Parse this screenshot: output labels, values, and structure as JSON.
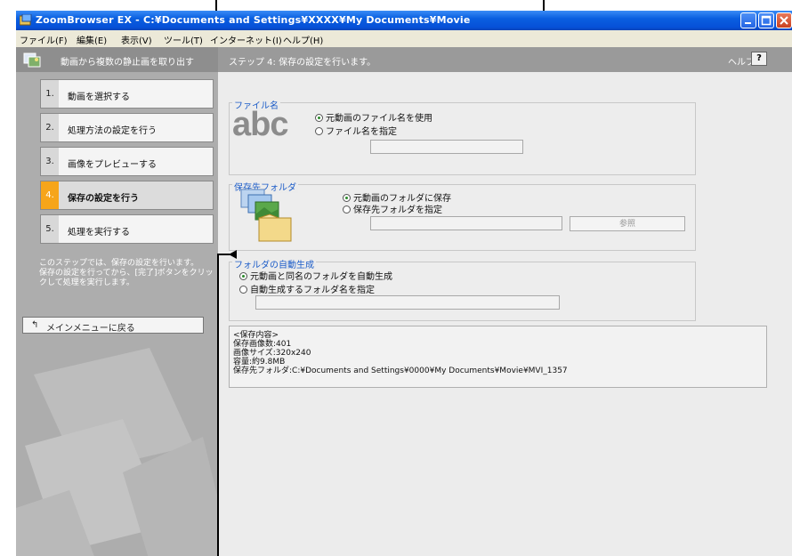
{
  "window": {
    "title": "ZoomBrowser EX - C:¥Documents and Settings¥XXXX¥My Documents¥Movie",
    "help_button_label": "?"
  },
  "menu": [
    "ファイル(F)",
    "編集(E)",
    "表示(V)",
    "ツール(T)",
    "インターネット(I)",
    "ヘルプ(H)"
  ],
  "header": {
    "left_label": "動画から複数の静止画を取り出す",
    "step_title": "ステップ 4: 保存の設定を行います。",
    "help_label": "ヘルプ"
  },
  "steps": [
    {
      "num": "1.",
      "label": "動画を選択する",
      "active": false
    },
    {
      "num": "2.",
      "label": "処理方法の設定を行う",
      "active": false
    },
    {
      "num": "3.",
      "label": "画像をプレビューする",
      "active": false
    },
    {
      "num": "4.",
      "label": "保存の設定を行う",
      "active": true
    },
    {
      "num": "5.",
      "label": "処理を実行する",
      "active": false
    }
  ],
  "step_description": [
    "このステップでは、保存の設定を行います。",
    "保存の設定を行ってから、[完了]ボタンをクリックして処理を実行します。"
  ],
  "main_menu_button": {
    "label": "メインメニューに戻る",
    "icon": "return-arrow-icon"
  },
  "file_name_group": {
    "label": "ファイル名",
    "logo_text": "abc",
    "options": [
      {
        "label": "元動画のファイル名を使用",
        "selected": true
      },
      {
        "label": "ファイル名を指定",
        "selected": false
      }
    ],
    "input_value": ""
  },
  "save_folder_group": {
    "label": "保存先フォルダ",
    "options": [
      {
        "label": "元動画のフォルダに保存",
        "selected": true
      },
      {
        "label": "保存先フォルダを指定",
        "selected": false
      }
    ],
    "input_value": "",
    "browse_label": "参照"
  },
  "auto_folder_group": {
    "label": "フォルダの自動生成",
    "options": [
      {
        "label": "元動画と同名のフォルダを自動生成",
        "selected": true
      },
      {
        "label": "自動生成するフォルダ名を指定",
        "selected": false
      }
    ],
    "input_value": ""
  },
  "summary": [
    "<保存内容>",
    "保存画像数:401",
    "画像サイズ:320x240",
    "容量:約9.8MB",
    "保存先フォルダ:C:¥Documents and Settings¥0000¥My Documents¥Movie¥MVI_1357"
  ],
  "colors": {
    "title_bar": "#0a5fe0",
    "active_step": "#f6a51a",
    "group_label": "#1c5cc8",
    "panel_gray": "#adadad",
    "callout": "#000000"
  }
}
